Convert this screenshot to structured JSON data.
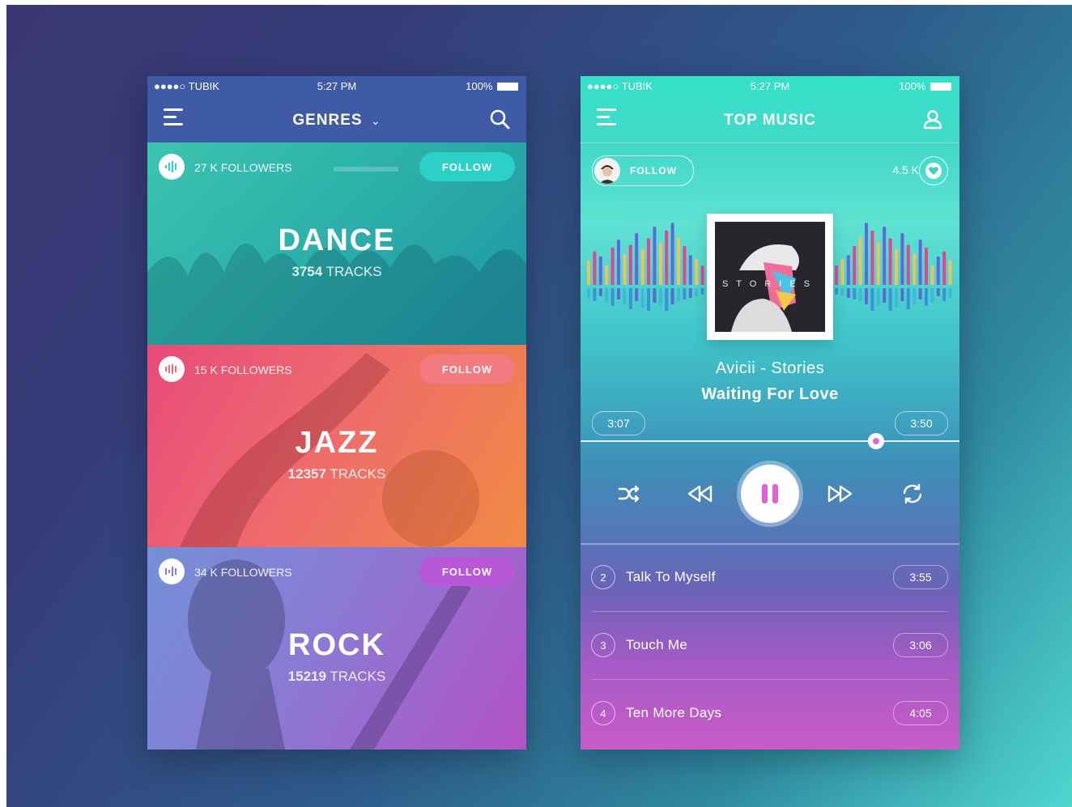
{
  "left_phone": {
    "status": {
      "carrier": "●●●●○ TUBIK",
      "time": "5:27 PM",
      "battery": "100%"
    },
    "nav": {
      "title": "GENRES",
      "dropdown_glyph": "⌄",
      "menu_icon": "hamburger-menu-icon",
      "search_icon": "search-icon"
    },
    "genres": [
      {
        "name": "DANCE",
        "followers": "27 K FOLLOWERS",
        "follow_label": "FOLLOW",
        "track_count": "3754",
        "tracks_label": "TRACKS"
      },
      {
        "name": "JAZZ",
        "followers": "15 K FOLLOWERS",
        "follow_label": "FOLLOW",
        "track_count": "12357",
        "tracks_label": "TRACKS"
      },
      {
        "name": "ROCK",
        "followers": "34 K FOLLOWERS",
        "follow_label": "FOLLOW",
        "track_count": "15219",
        "tracks_label": "TRACKS"
      }
    ]
  },
  "right_phone": {
    "status": {
      "carrier": "●●●●○ TUBIK",
      "time": "5:27 PM",
      "battery": "100%"
    },
    "nav": {
      "title": "TOP MUSIC",
      "menu_icon": "hamburger-menu-icon",
      "profile_icon": "user-icon"
    },
    "artist": {
      "follow_label": "FOLLOW",
      "likes": "4.5 K"
    },
    "album_text": "STORIES",
    "now_playing": {
      "artist_album": "Avicii - Stories",
      "title": "Waiting For Love"
    },
    "elapsed": "3:07",
    "total": "3:50",
    "progress": 0.78,
    "controls": [
      "shuffle-icon",
      "rewind-icon",
      "pause-icon",
      "fast-forward-icon",
      "repeat-icon"
    ],
    "tracks": [
      {
        "number": "2",
        "title": "Talk To Myself",
        "duration": "3:55"
      },
      {
        "number": "3",
        "title": "Touch Me",
        "duration": "3:06"
      },
      {
        "number": "4",
        "title": "Ten More Days",
        "duration": "4:05"
      }
    ]
  },
  "colors": {
    "accent_teal": "#2bd0c7",
    "accent_pink": "#e36ad2",
    "accent_purple": "#b957d9"
  }
}
